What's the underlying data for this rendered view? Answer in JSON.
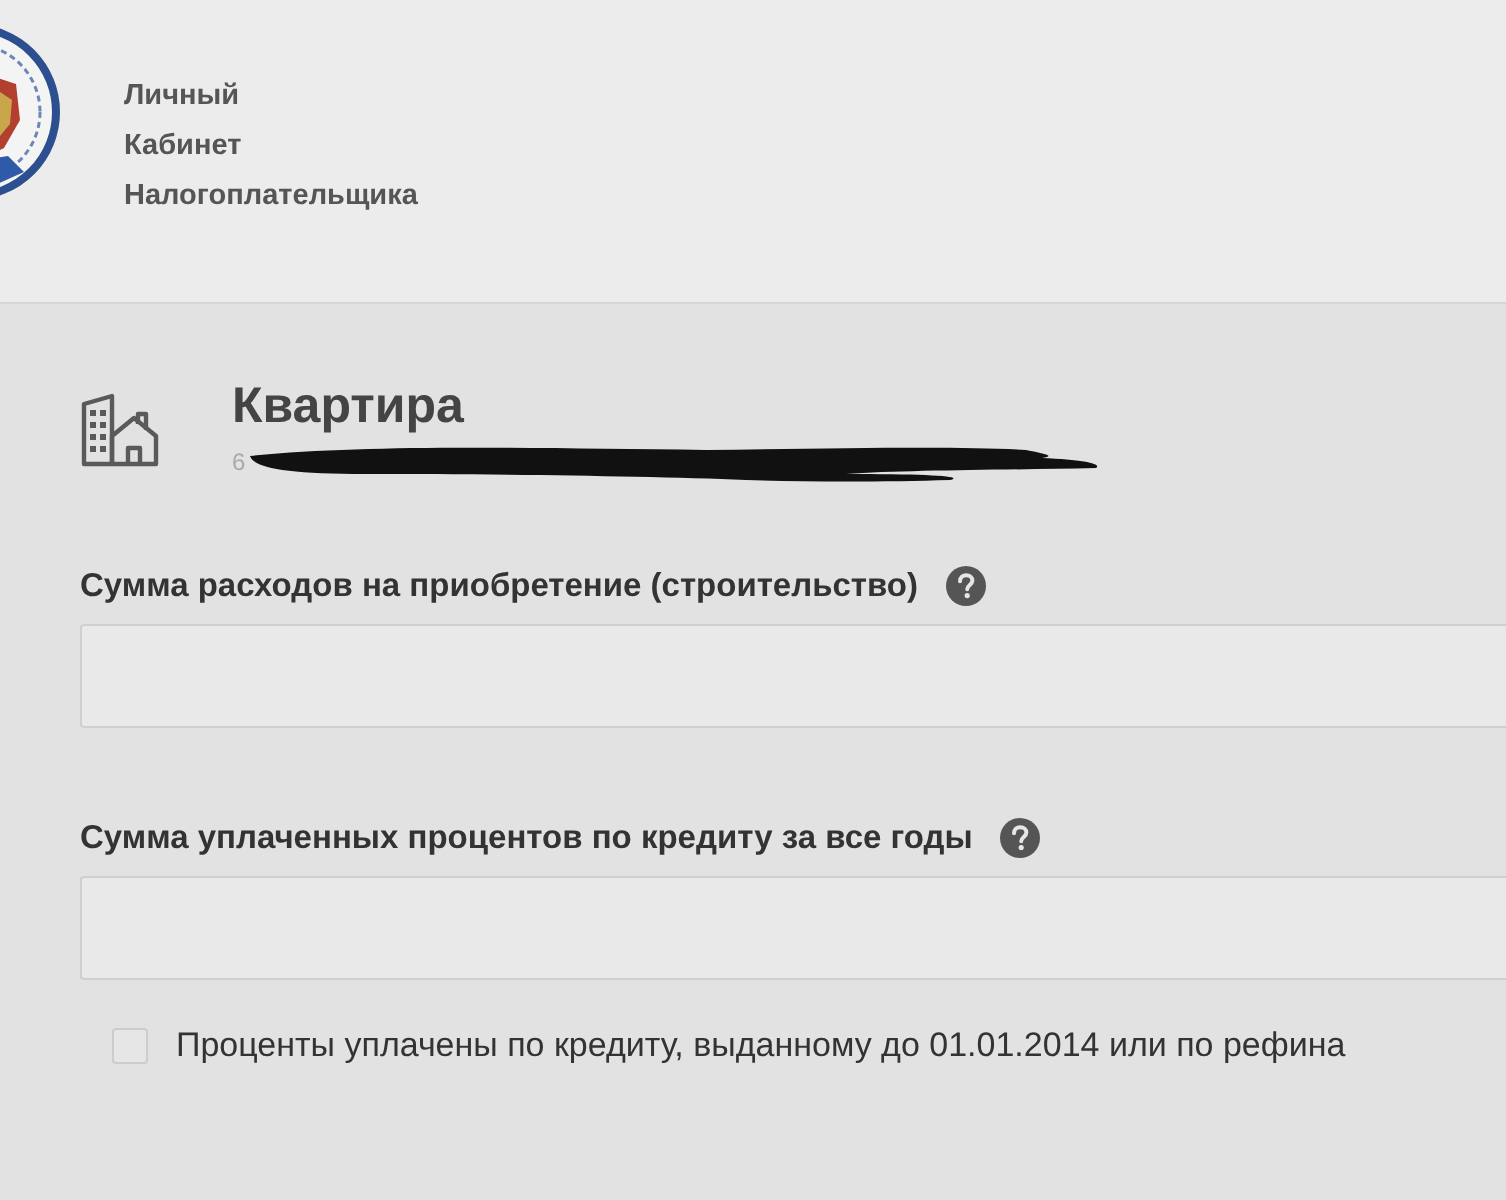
{
  "header": {
    "title_lines": [
      "Личный",
      "Кабинет",
      "Налогоплательщика"
    ]
  },
  "property": {
    "title": "Квартира",
    "subtitle": "6"
  },
  "fields": [
    {
      "label": "Сумма расходов на приобретение (строительство)"
    },
    {
      "label": "Сумма уплаченных процентов по кредиту за все годы"
    }
  ],
  "checkbox": {
    "label": "Проценты уплачены по кредиту, выданному до 01.01.2014 или по рефина",
    "checked": false
  }
}
